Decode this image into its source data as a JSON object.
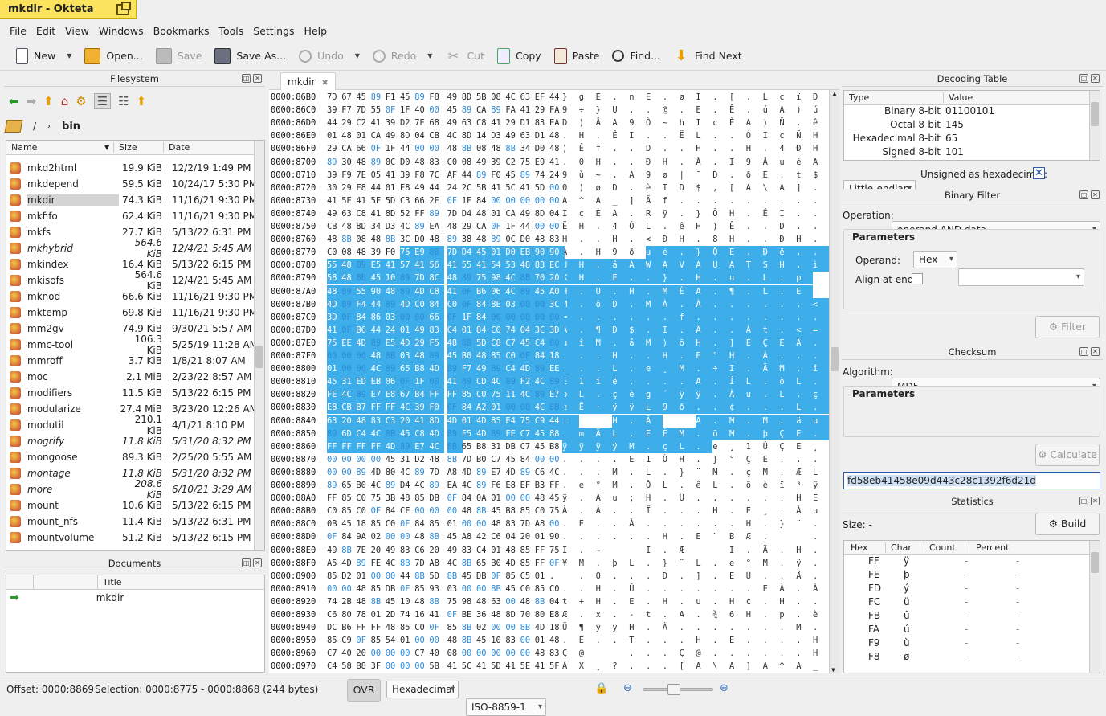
{
  "window": {
    "title": "mkdir - Okteta"
  },
  "menu": [
    "File",
    "Edit",
    "View",
    "Windows",
    "Bookmarks",
    "Tools",
    "Settings",
    "Help"
  ],
  "toolbar": {
    "new": "New",
    "open": "Open...",
    "save": "Save",
    "saveas": "Save As...",
    "undo": "Undo",
    "redo": "Redo",
    "cut": "Cut",
    "copy": "Copy",
    "paste": "Paste",
    "find": "Find...",
    "findnext": "Find Next"
  },
  "filesystem": {
    "title": "Filesystem",
    "path_root": "/",
    "path_dir": "bin",
    "col_name": "Name",
    "col_size": "Size",
    "col_date": "Date",
    "files": [
      {
        "name": "mkd2html",
        "size": "19.9 KiB",
        "date": "12/2/19 1:49 PM",
        "italic": false
      },
      {
        "name": "mkdepend",
        "size": "59.5 KiB",
        "date": "10/24/17 5:30 PM",
        "italic": false
      },
      {
        "name": "mkdir",
        "size": "74.3 KiB",
        "date": "11/16/21 9:30 PM",
        "italic": false,
        "selected": true
      },
      {
        "name": "mkfifo",
        "size": "62.4 KiB",
        "date": "11/16/21 9:30 PM",
        "italic": false
      },
      {
        "name": "mkfs",
        "size": "27.7 KiB",
        "date": "5/13/22 6:31 PM",
        "italic": false
      },
      {
        "name": "mkhybrid",
        "size": "564.6 KiB",
        "date": "12/4/21 5:45 AM",
        "italic": true
      },
      {
        "name": "mkindex",
        "size": "16.4 KiB",
        "date": "5/13/22 6:15 PM",
        "italic": false
      },
      {
        "name": "mkisofs",
        "size": "564.6 KiB",
        "date": "12/4/21 5:45 AM",
        "italic": false
      },
      {
        "name": "mknod",
        "size": "66.6 KiB",
        "date": "11/16/21 9:30 PM",
        "italic": false
      },
      {
        "name": "mktemp",
        "size": "69.8 KiB",
        "date": "11/16/21 9:30 PM",
        "italic": false
      },
      {
        "name": "mm2gv",
        "size": "74.9 KiB",
        "date": "9/30/21 5:57 AM",
        "italic": false
      },
      {
        "name": "mmc-tool",
        "size": "106.3 KiB",
        "date": "5/25/19 11:28 AM",
        "italic": false
      },
      {
        "name": "mmroff",
        "size": "3.7 KiB",
        "date": "1/8/21 8:07 AM",
        "italic": false
      },
      {
        "name": "moc",
        "size": "2.1 MiB",
        "date": "2/23/22 8:57 AM",
        "italic": false
      },
      {
        "name": "modifiers",
        "size": "11.5 KiB",
        "date": "5/13/22 6:15 PM",
        "italic": false
      },
      {
        "name": "modularize",
        "size": "27.4 MiB",
        "date": "3/23/20 12:26 AM",
        "italic": false
      },
      {
        "name": "modutil",
        "size": "210.1 KiB",
        "date": "4/1/21 8:10 PM",
        "italic": false
      },
      {
        "name": "mogrify",
        "size": "11.8 KiB",
        "date": "5/31/20 8:32 PM",
        "italic": true
      },
      {
        "name": "mongoose",
        "size": "89.3 KiB",
        "date": "2/25/20 5:55 AM",
        "italic": false
      },
      {
        "name": "montage",
        "size": "11.8 KiB",
        "date": "5/31/20 8:32 PM",
        "italic": true
      },
      {
        "name": "more",
        "size": "208.6 KiB",
        "date": "6/10/21 3:29 AM",
        "italic": true
      },
      {
        "name": "mount",
        "size": "10.6 KiB",
        "date": "5/13/22 6:15 PM",
        "italic": false
      },
      {
        "name": "mount_nfs",
        "size": "11.4 KiB",
        "date": "5/13/22 6:31 PM",
        "italic": false
      },
      {
        "name": "mountvolume",
        "size": "51.2 KiB",
        "date": "5/13/22 6:15 PM",
        "italic": false
      }
    ]
  },
  "documents": {
    "title": "Documents",
    "col_title": "Title",
    "items": [
      "mkdir"
    ]
  },
  "editor": {
    "tab": "mkdir",
    "rows": [
      [
        "0000:86B0",
        "7D 67 45 89 F1 45 89 F8 49 8D 5B 08 4C 63 EF 44",
        "} g E . n E . ø I . [ . L c ï D"
      ],
      [
        "0000:86C0",
        "39 F7 7D 55 0F 1F 40 00 45 89 CA 89 FA 41 29 FA",
        "9 ÷ } U . . @ . E . Ê . ú A ) ú"
      ],
      [
        "0000:86D0",
        "44 29 C2 41 39 D2 7E 68 49 63 C8 41 29 D1 83 EA",
        "D ) Â A 9 Ò ~ h I c È A ) Ñ . ê"
      ],
      [
        "0000:86E0",
        "01 48 01 CA 49 8D 04 CB 4C 8D 14 D3 49 63 D1 48",
        ". H . Ê I . . Ë L . . Ó I c Ñ H"
      ],
      [
        "0000:86F0",
        "29 CA 66 0F 1F 44 00 00 48 8B 08 48 8B 34 D0 48",
        ") Ê f . . D . . H . . H . 4 Ð H"
      ],
      [
        "0000:8700",
        "89 30 48 89 0C D0 48 83 C0 08 49 39 C2 75 E9 41",
        ". 0 H . . Ð H . À . I 9 Â u é A"
      ],
      [
        "0000:8710",
        "39 F9 7E 05 41 39 F8 7C AF 44 89 F0 45 89 74 24",
        "9 ù ~ . A 9 ø | ¯ D . ð E . t $"
      ],
      [
        "0000:8720",
        "30 29 F8 44 01 E8 49 44 24 2C 5B 41 5C 41 5D 00",
        "0 ) ø D . è I D $ , [ A \\ A ] ."
      ],
      [
        "0000:8730",
        "41 5E 41 5F 5D C3 66 2E 0F 1F 84 00 00 00 00 00",
        "A ^ A _ ] Ã f . . . . . . . . ."
      ],
      [
        "0000:8740",
        "49 63 C8 41 8D 52 FF 89 7D D4 48 01 CA 49 8D 04",
        "I c È A . R ÿ . } Ô H . Ê I . ."
      ],
      [
        "0000:8750",
        "CB 48 8D 34 D3 4C 89 EA 48 29 CA 0F 1F 44 00 00",
        "Ë H . 4 Ó L . ê H ) Ê . . D . ."
      ],
      [
        "0000:8760",
        "48 8B 08 48 8B 3C D0 48 89 38 48 89 0C D0 48 83",
        "H . . H . < Ð H . 8 H . . Ð H ."
      ],
      [
        "0000:8770",
        "C0 08 48 39 F0 75 E9 8B 7D D4 45 01 D0 EB 90 90",
        "À . H 9 ð u é . } Ô E . Ð ë . ."
      ],
      [
        "0000:8780",
        "55 48 89 E5 41 57 41 56 41 55 41 54 53 48 83 EC",
        "U H . å A W A V A U A T S H . ì"
      ],
      [
        "0000:8790",
        "58 48 8B 45 10 89 7D 8C 48 89 75 98 4C 8B 70 20",
        "X H . E . . } . H . u . L . p  "
      ],
      [
        "0000:87A0",
        "48 89 55 90 48 89 4D C8 41 0F B6 06 4C 89 45 A0",
        "H . U . H . M È A . ¶ . L . E  "
      ],
      [
        "0000:87B0",
        "4D 89 F4 44 89 4D C0 84 C0 0F 84 8E 03 00 00 3C",
        "M . ô D . M À . À . . . . . . <"
      ],
      [
        "0000:87C0",
        "3D 0F 84 86 03 00 00 66 0F 1F 84 00 00 00 00 00",
        "= . . . . . . f . . . . . . . ."
      ],
      [
        "0000:87D0",
        "41 0F B6 44 24 01 49 83 C4 01 84 C0 74 04 3C 3D",
        "A . ¶ D $ . I . Ä . . À t . < ="
      ],
      [
        "0000:87E0",
        "75 EE 4D 89 E5 4D 29 F5 48 8B 5D C8 C7 45 C4 00",
        "u î M . å M ) õ H . ] È Ç E Ä ."
      ],
      [
        "0000:87F0",
        "00 00 00 48 8B 03 48 89 45 B0 48 85 C0 0F 84 18",
        ". . . H . . H . E ° H . À . . ."
      ],
      [
        "0000:8800",
        "01 00 00 4C 89 65 B8 4D 89 F7 49 89 C4 4D 89 EE",
        ". . . L . e ¸ M . ÷ I . Ä M . î"
      ],
      [
        "0000:8810",
        "45 31 ED EB 06 0F 1F 00 41 89 CD 4C 89 F2 4C 89",
        "E 1 í ë . . . . A . Í L . ò L ."
      ],
      [
        "0000:8820",
        "FE 4C 89 E7 E8 67 B4 FF FF 85 C0 75 11 4C 89 E7",
        "þ L . ç è g ´ ÿ ÿ . À u . L . ç"
      ],
      [
        "0000:8830",
        "E8 CB B7 FF FF 4C 39 F0 0F 84 A2 01 00 00 4C 8B",
        "è Ë · ÿ ÿ L 9 ð . . ¢ . . . L ."
      ],
      [
        "0000:8840",
        "63 20 48 83 C3 20 41 8D 4D 01 4D 85 E4 75 C9 44",
        "c   H . Ã   A . M . M . ä u É D"
      ],
      [
        "0000:8850",
        "89 6D C4 4C 8B 45 C8 4D 89 F5 4D 89 FE C7 45 88",
        ". m Ä L . E È M . õ M . þ Ç E ."
      ],
      [
        "0000:8860",
        "FF FF FF FF 4D 89 E7 4C 8B 65 B8 31 DB C7 45 B8",
        "ÿ ÿ ÿ ÿ M . ç L . e ¸ 1 Û Ç E ¸"
      ],
      [
        "0000:8870",
        "00 00 00 00 45 31 D2 48 8B 7D B0 C7 45 84 00 00",
        ". . . . E 1 Ò H . } ° Ç E . . ."
      ],
      [
        "0000:8880",
        "00 00 89 4D 80 4C 89 7D A8 4D 89 E7 4D 89 C6 4C",
        ". . . M . L . } ¨ M . ç M . Æ L"
      ],
      [
        "0000:8890",
        "89 65 B0 4C 89 D4 4C 89 EA 4C 89 F6 E8 EF B3 FF",
        ". e ° M . Ô L . ê L . ö è ï ³ ÿ"
      ],
      [
        "0000:88A0",
        "FF 85 C0 75 3B 48 85 DB 0F 84 0A 01 00 00 48 45",
        "ÿ . À u ; H . Û . . . . . . H E"
      ],
      [
        "0000:88B0",
        "C0 85 C0 0F 84 CF 00 00 00 48 8B 45 B8 85 C0 75",
        "À . À . . Ï . . . H . E ¸ . À u"
      ],
      [
        "0000:88C0",
        "0B 45 18 85 C0 0F 84 85 01 00 00 48 83 7D A8 00",
        ". E . . À . . . . . . H . } ¨ ."
      ],
      [
        "0000:88D0",
        "0F 84 9A 02 00 00 48 8B 45 A8 42 C6 04 20 01 90",
        ". . . . . . H . E ¨ B Æ .   . ."
      ],
      [
        "0000:88E0",
        "49 8B 7E 20 49 83 C6 20 49 83 C4 01 48 85 FF 75",
        "I . ~   I . Æ   I . Ä . H . ÿ u"
      ],
      [
        "0000:88F0",
        "A5 4D 89 FE 4C 8B 7D A8 4C 8B 65 B0 4D 85 FF 0F",
        "¥ M . þ L . } ¨ L . e ° M . ÿ ."
      ],
      [
        "0000:8900",
        "85 D2 01 00 00 44 8B 5D 8B 45 DB 0F 85 C5 01 .",
        " . Ò . . . D . ] . E Û . . Å . "
      ],
      [
        "0000:8910",
        "00 00 48 85 DB 0F 85 93 03 00 00 8B 45 C0 85 C0",
        ". . H . Û . . . . . . . E À . À"
      ],
      [
        "0000:8920",
        "74 2B 48 8B 45 10 48 8B 75 98 48 63 00 48 8B 04",
        "t + H . E . H . u . H c . H . ."
      ],
      [
        "0000:8930",
        "C6 80 78 01 2D 74 16 41 0F BE 36 48 8D 70 80 E8",
        "Æ . x . - t . A . ¾ 6 H . p . è"
      ],
      [
        "0000:8940",
        "DC B6 FF FF 48 85 C0 0F 85 8B 02 00 00 8B 4D 18",
        "Ü ¶ ÿ ÿ H . À . . . . . . . M ."
      ],
      [
        "0000:8950",
        "85 C9 0F 85 54 01 00 00 48 8B 45 10 83 00 01 48",
        ". É . . T . . . H . E . . . . H"
      ],
      [
        "0000:8960",
        "C7 40 20 00 00 00 C7 40 08 00 00 00 00 00 48 83",
        "Ç @   . . . Ç @ . . . . . . H ."
      ],
      [
        "0000:8970",
        "C4 58 B8 3F 00 00 00 5B 41 5C 41 5D 41 5E 41 5F",
        "Ä X ¸ ? . . . [ A \\ A ] A ^ A _"
      ]
    ]
  },
  "decoding": {
    "title": "Decoding Table",
    "col_type": "Type",
    "col_value": "Value",
    "rows": [
      [
        "Binary 8-bit",
        "01100101"
      ],
      [
        "Octal 8-bit",
        "145"
      ],
      [
        "Hexadecimal 8-bit",
        "65"
      ],
      [
        "Signed 8-bit",
        "101"
      ]
    ],
    "endian": "Little-endian",
    "unsigned_label": "Unsigned as hexadecimal:"
  },
  "binaryfilter": {
    "title": "Binary Filter",
    "operation_label": "Operation:",
    "operation": "operand AND data",
    "params": "Parameters",
    "operand_label": "Operand:",
    "operand_format": "Hex",
    "align_label": "Align at end:",
    "filter": "Filter"
  },
  "checksum": {
    "title": "Checksum",
    "algorithm_label": "Algorithm:",
    "algorithm": "MD5",
    "params": "Parameters",
    "calculate": "Calculate",
    "result": "fd58eb41458e09d443c28c1392f6d21d"
  },
  "statistics": {
    "title": "Statistics",
    "size_label": "Size: -",
    "build": "Build",
    "col_hex": "Hex",
    "col_char": "Char",
    "col_count": "Count",
    "col_percent": "Percent",
    "rows": [
      [
        "FF",
        "ÿ",
        "-",
        "-"
      ],
      [
        "FE",
        "þ",
        "-",
        "-"
      ],
      [
        "FD",
        "ý",
        "-",
        "-"
      ],
      [
        "FC",
        "ü",
        "-",
        "-"
      ],
      [
        "FB",
        "û",
        "-",
        "-"
      ],
      [
        "FA",
        "ú",
        "-",
        "-"
      ],
      [
        "F9",
        "ù",
        "-",
        "-"
      ],
      [
        "F8",
        "ø",
        "-",
        "-"
      ]
    ]
  },
  "status": {
    "offset": "Offset: 0000:8869",
    "selection": "Selection: 0000:8775 - 0000:8868 (244 bytes)",
    "mode": "OVR",
    "encoding": "Hexadecimal",
    "charset": "ISO-8859-1"
  }
}
